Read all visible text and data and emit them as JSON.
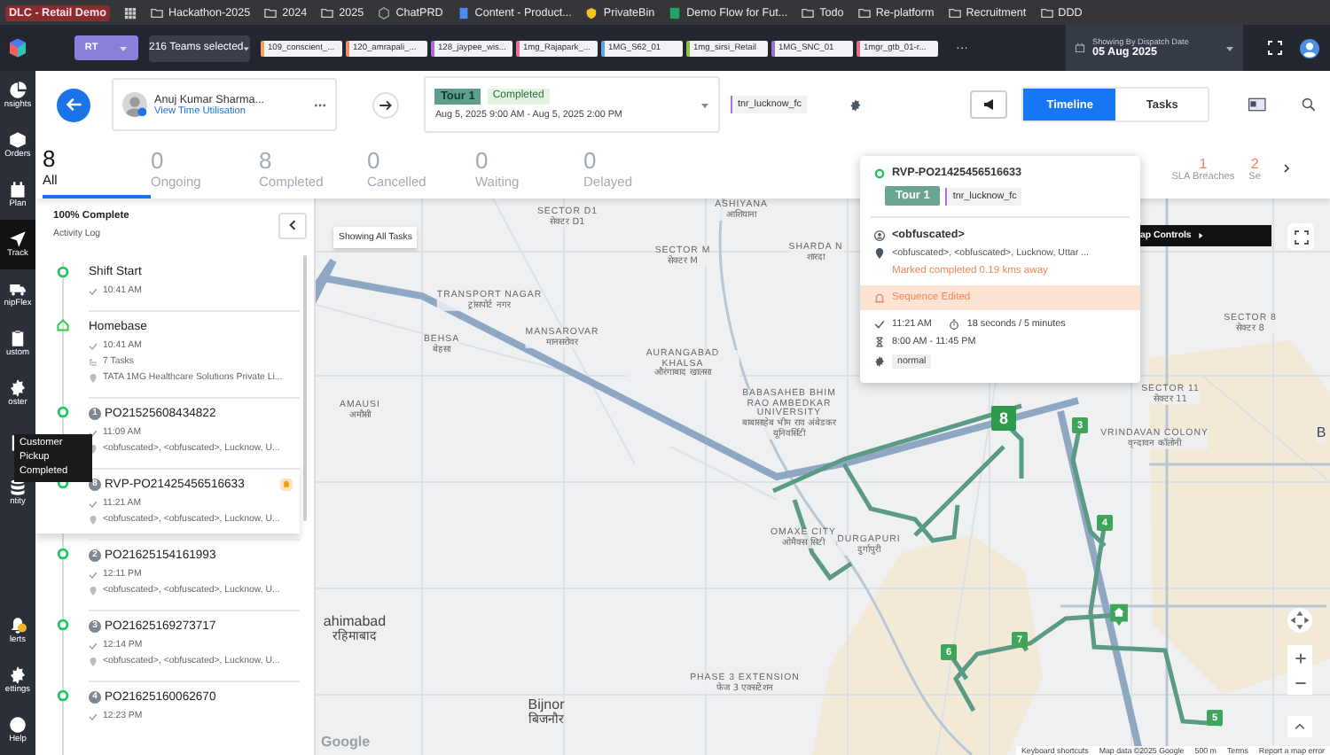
{
  "browser_bookmarks": {
    "tab_group": "DLC - Retail Demo",
    "items": [
      {
        "kind": "folder",
        "label": "Hackathon-2025"
      },
      {
        "kind": "folder",
        "label": "2024"
      },
      {
        "kind": "folder",
        "label": "2025"
      },
      {
        "kind": "site",
        "label": "ChatPRD"
      },
      {
        "kind": "doc",
        "label": "Content - Product..."
      },
      {
        "kind": "key",
        "label": "PrivateBin"
      },
      {
        "kind": "sheet",
        "label": "Demo Flow for Fut..."
      },
      {
        "kind": "folder",
        "label": "Todo"
      },
      {
        "kind": "folder",
        "label": "Re-platform"
      },
      {
        "kind": "folder",
        "label": "Recruitment"
      },
      {
        "kind": "folder",
        "label": "DDD"
      }
    ]
  },
  "header": {
    "org_button": "RT",
    "teams_dropdown": "216 Teams selected",
    "team_chips": [
      {
        "label": "109_conscient_...",
        "color": "#f4a261"
      },
      {
        "label": "120_amrapali_...",
        "color": "#f08a6c"
      },
      {
        "label": "128_jaypee_wis...",
        "color": "#b06ad8"
      },
      {
        "label": "1mg_Rajapark_...",
        "color": "#e57399"
      },
      {
        "label": "1MG_S62_01",
        "color": "#5aa6e8"
      },
      {
        "label": "1mg_sirsi_Retail",
        "color": "#8bc34a"
      },
      {
        "label": "1MG_SNC_01",
        "color": "#9575cd"
      },
      {
        "label": "1mgr_gtb_01-r...",
        "color": "#ec6a8a"
      }
    ],
    "more": "···",
    "date_picker": {
      "caption": "Showing By Dispatch Date",
      "value": "05 Aug 2025"
    }
  },
  "nav": [
    {
      "label": "nsights",
      "selected": false
    },
    {
      "label": "Orders",
      "selected": false
    },
    {
      "label": "Plan",
      "selected": false
    },
    {
      "label": "Track",
      "selected": true
    },
    {
      "label": "nipFlex",
      "selected": false
    },
    {
      "label": "ustom",
      "selected": false
    },
    {
      "label": "oster",
      "selected": false
    },
    {
      "selected": false
    },
    {
      "label": "ntity",
      "selected": false
    },
    {
      "label": "lerts",
      "selected": false,
      "has_alert": true
    },
    {
      "label": "ettings",
      "selected": false
    },
    {
      "label": "Help",
      "selected": false
    }
  ],
  "tooltip": "Customer Pickup Completed",
  "driver": {
    "name": "Anuj Kumar Sharma...",
    "link": "View Time Utilisation"
  },
  "tour": {
    "name": "Tour 1",
    "status": "Completed",
    "window": "Aug 5, 2025 9:00 AM - Aug 5, 2025 2:00 PM"
  },
  "hub_tag": "tnr_lucknow_fc",
  "view_tabs": [
    {
      "label": "Timeline",
      "selected": true
    },
    {
      "label": "Tasks",
      "selected": false
    }
  ],
  "stats": [
    {
      "count": "8",
      "label": "All",
      "selected": true
    },
    {
      "count": "0",
      "label": "Ongoing",
      "selected": false
    },
    {
      "count": "8",
      "label": "Completed",
      "selected": false
    },
    {
      "count": "0",
      "label": "Cancelled",
      "selected": false
    },
    {
      "count": "0",
      "label": "Waiting",
      "selected": false
    },
    {
      "count": "0",
      "label": "Delayed",
      "selected": false
    }
  ],
  "extra_stats": [
    {
      "count": "1",
      "label": "SLA Breaches"
    },
    {
      "count": "2",
      "label": "Se"
    }
  ],
  "activity": {
    "progress": "100% Complete",
    "title": "Activity Log",
    "entries": [
      {
        "kind": "shift",
        "title": "Shift Start",
        "time": "10:41 AM",
        "selected": false
      },
      {
        "kind": "homebase",
        "title": "Homebase",
        "time": "10:41 AM",
        "tasks": "7 Tasks",
        "address": "TATA 1MG Healthcare Solutions Private Li...",
        "selected": false
      },
      {
        "kind": "task",
        "seq": "1",
        "title": "PO21525608434822",
        "time": "11:09 AM",
        "address": "<obfuscated>, <obfuscated>, Lucknow, U...",
        "selected": false,
        "flagged": false
      },
      {
        "kind": "task",
        "seq": "8",
        "title": "RVP-PO21425456516633",
        "time": "11:21 AM",
        "address": "<obfuscated>, <obfuscated>, Lucknow, U...",
        "selected": true,
        "flagged": true
      },
      {
        "kind": "task",
        "seq": "2",
        "title": "PO21625154161993",
        "time": "12:11 PM",
        "address": "<obfuscated>, <obfuscated>, Lucknow, U...",
        "selected": false,
        "flagged": false
      },
      {
        "kind": "task",
        "seq": "3",
        "title": "PO21625169273717",
        "time": "12:14 PM",
        "address": "<obfuscated>, <obfuscated>, Lucknow, U...",
        "selected": false,
        "flagged": false
      },
      {
        "kind": "task",
        "seq": "4",
        "title": "PO21625160062670",
        "time": "12:23 PM",
        "selected": false,
        "flagged": false
      }
    ]
  },
  "map": {
    "filter_chip": "Showing All Tasks",
    "controls_bar": "ap Controls",
    "labels": [
      {
        "kind": "area",
        "text": "SECTOR D1",
        "native": "सेक्टर D1"
      },
      {
        "kind": "area",
        "text": "ASHIYANA",
        "native": "आशियाना"
      },
      {
        "kind": "area",
        "text": "SECTOR M",
        "native": "सेक्टर M"
      },
      {
        "kind": "area",
        "text": "SHARDA N",
        "native": "शारदा"
      },
      {
        "kind": "area",
        "text": "TRANSPORT NAGAR",
        "native": "ट्रांसपोर्ट नगर"
      },
      {
        "kind": "area",
        "text": "MANSAROVAR",
        "native": "मानसरोवर"
      },
      {
        "kind": "area",
        "text": "BEHSA",
        "native": "बेहसा"
      },
      {
        "kind": "area",
        "text": "AURANGABAD KHALSA",
        "native": "औरंगाबाद खालसा"
      },
      {
        "kind": "area",
        "text": "AMAUSI",
        "native": "अमौसी"
      },
      {
        "kind": "area",
        "text": "BABASAHEB BHIM RAO AMBEDKAR UNIVERSITY",
        "native": "बाबासाहेब भीम राव अंबेडकर यूनिवर्सिटी"
      },
      {
        "kind": "area",
        "text": "OMAXE CITY",
        "native": "ओमैक्स सिटी"
      },
      {
        "kind": "area",
        "text": "DURGAPURI",
        "native": "दुर्गापुरी"
      },
      {
        "kind": "area",
        "text": "VRINDAVAN COLONY",
        "native": "वृन्दावन कॉलोनी"
      },
      {
        "kind": "area",
        "text": "SECTOR 8",
        "native": "सेक्टर 8"
      },
      {
        "kind": "area",
        "text": "SECTOR 11",
        "native": "सेक्टर 11"
      },
      {
        "kind": "place",
        "text": "ahimabad",
        "native": "रहिमाबाद"
      },
      {
        "kind": "place",
        "text": "Bijnor",
        "native": "बिजनौर"
      },
      {
        "kind": "area",
        "text": "PHASE 3 EXTENSION",
        "native": "फेज 3 एक्सटेंशन"
      },
      {
        "kind": "place",
        "text": "B"
      }
    ],
    "markers": [
      {
        "kind": "number",
        "label": "8",
        "selected": true
      },
      {
        "kind": "number",
        "label": "3",
        "selected": false
      },
      {
        "kind": "number",
        "label": "4",
        "selected": false
      },
      {
        "kind": "home",
        "selected": false
      },
      {
        "kind": "number",
        "label": "7",
        "selected": false
      },
      {
        "kind": "number",
        "label": "6",
        "selected": false
      },
      {
        "kind": "number",
        "label": "5",
        "selected": false
      }
    ],
    "logo": "Google",
    "footer": [
      "Keyboard shortcuts",
      "Map data ©2025 Google",
      "500 m",
      "Terms",
      "Report a map error"
    ]
  },
  "popup": {
    "task_id": "RVP-PO21425456516633",
    "tour": "Tour 1",
    "hub": "tnr_lucknow_fc",
    "customer": "<obfuscated>",
    "address": "<obfuscated>, <obfuscated>, Lucknow, Uttar ...",
    "warning": "Marked completed 0.19 kms away",
    "notice": "Sequence Edited",
    "completed_at": "11:21 AM",
    "duration": "18 seconds / 5 minutes",
    "time_window": "8:00 AM - 11:45 PM",
    "priority": "normal"
  }
}
